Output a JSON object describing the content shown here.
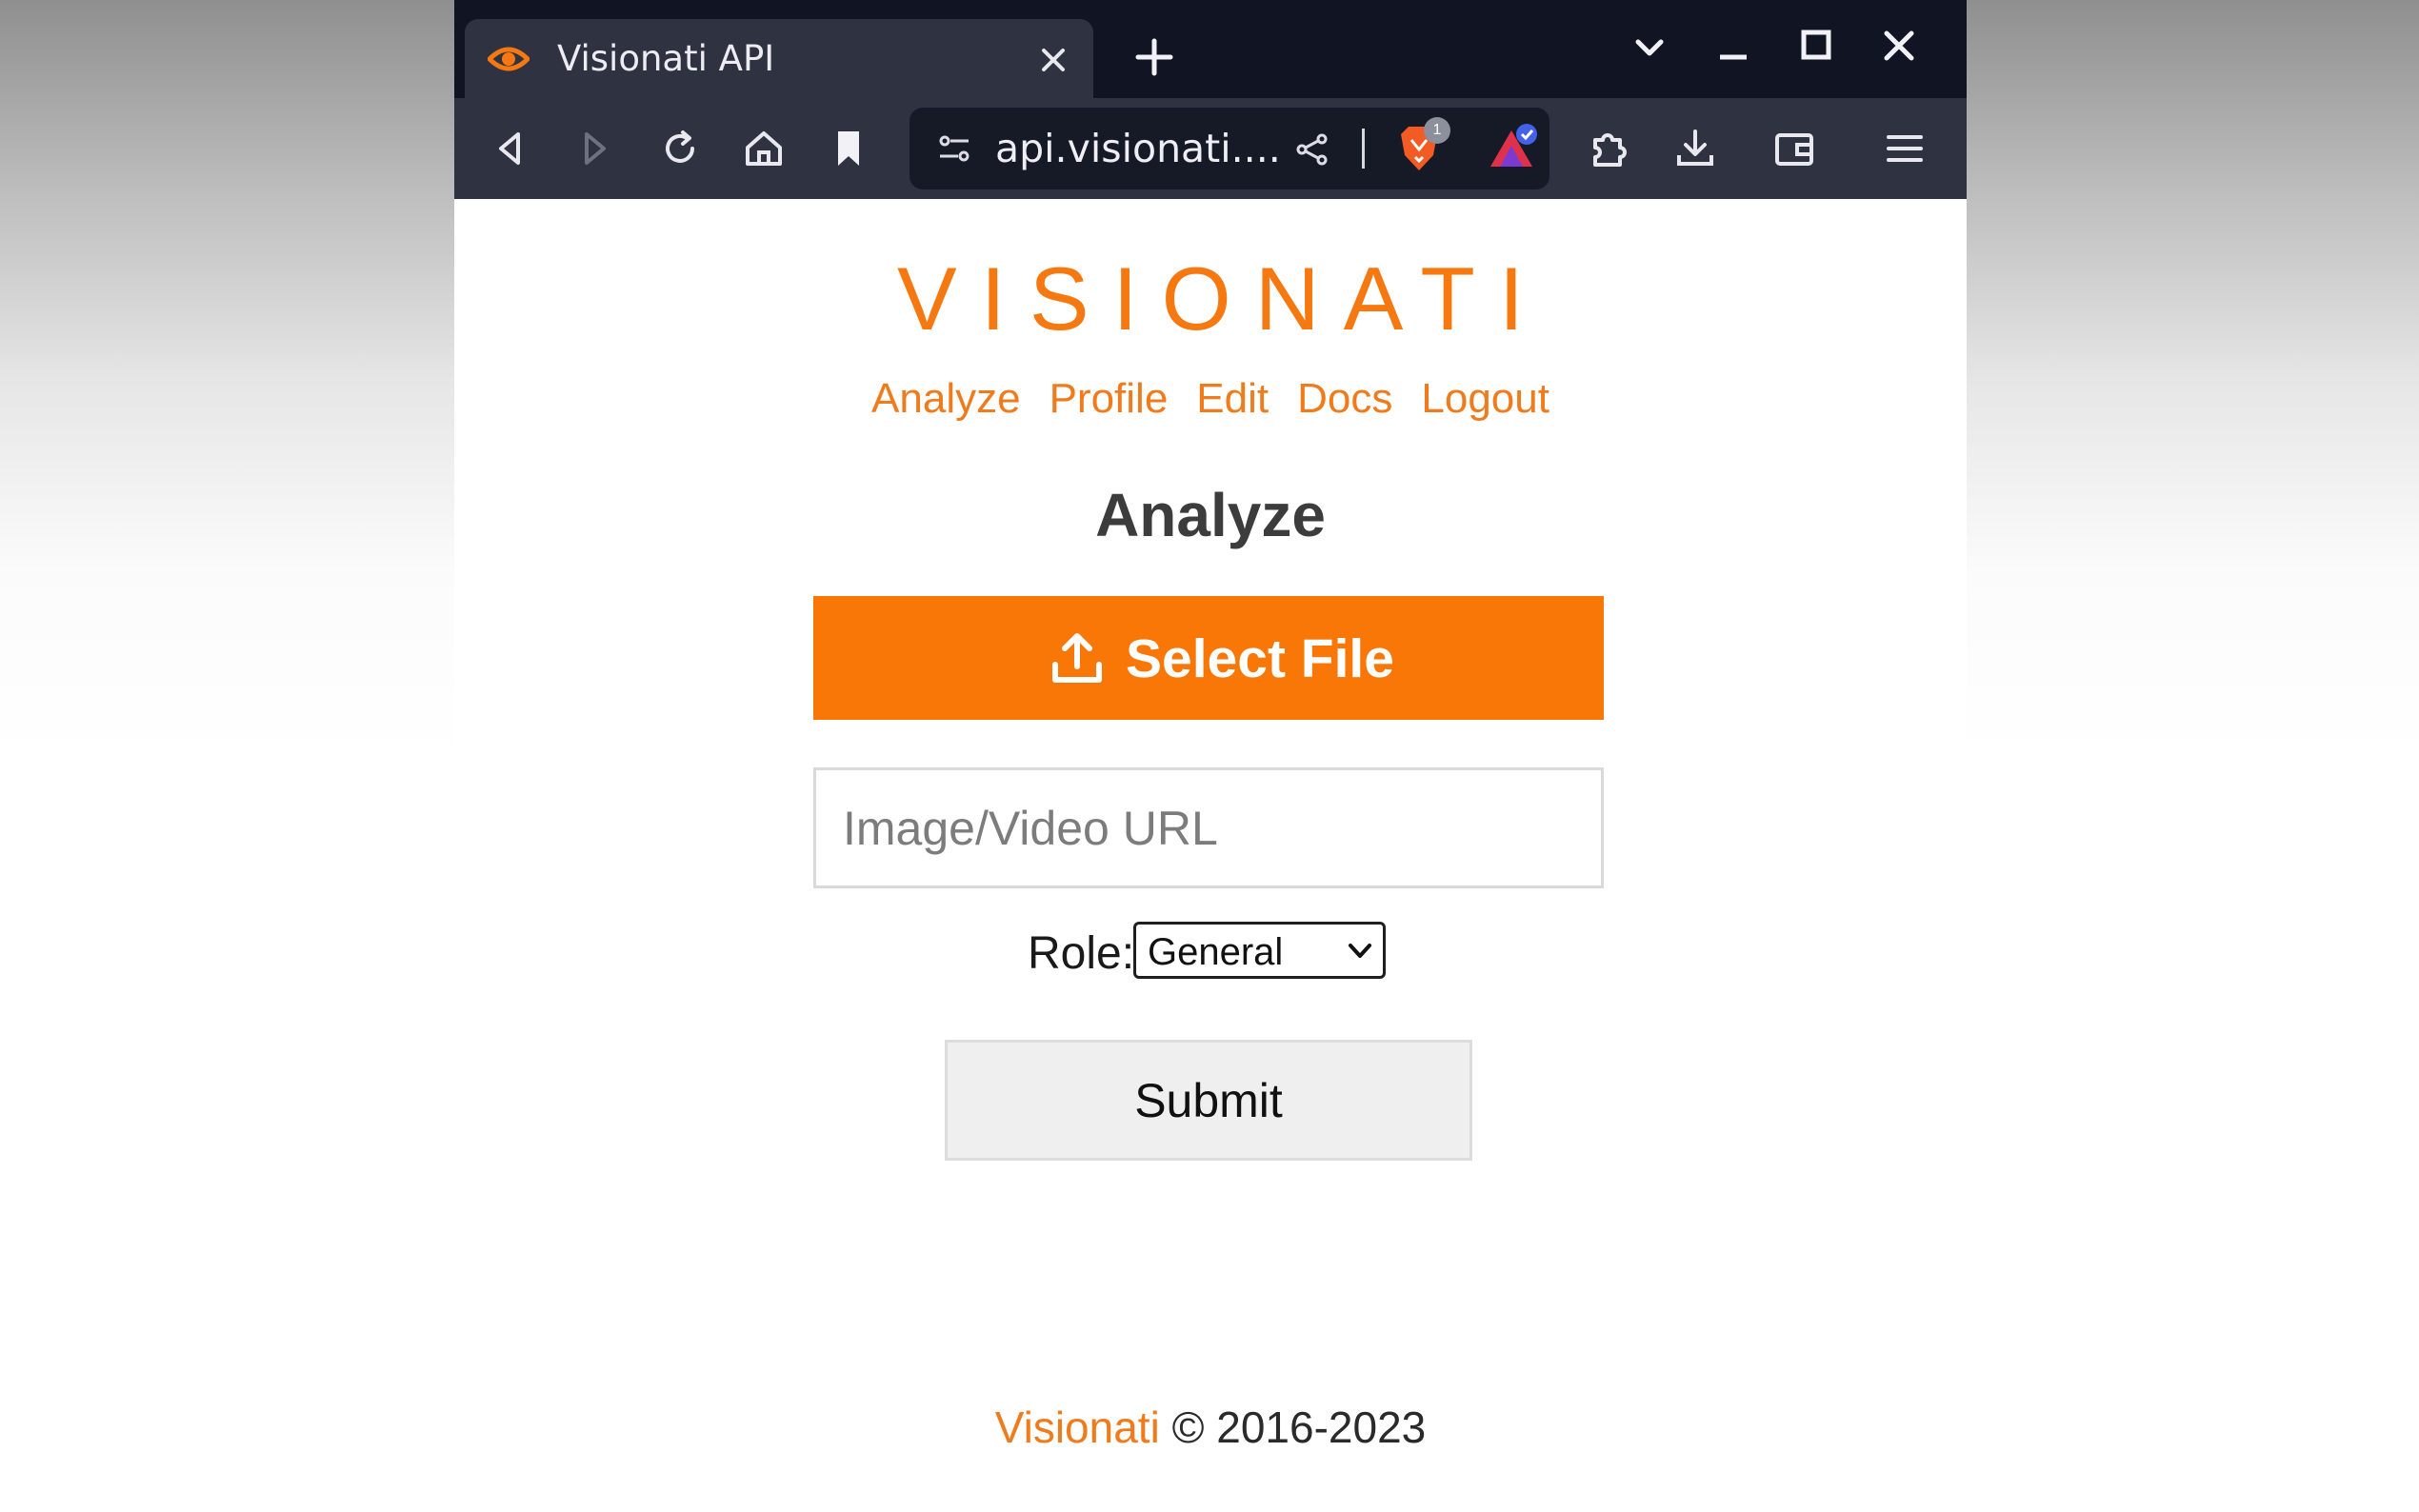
{
  "browser": {
    "tab": {
      "title": "Visionati API",
      "favicon": "eye-icon"
    },
    "address_bar": {
      "url_display": "api.visionati...."
    },
    "shields_badge": "1",
    "icons": [
      "back-icon",
      "forward-icon",
      "reload-icon",
      "home-icon",
      "bookmark-icon",
      "site-settings-icon",
      "share-icon",
      "brave-shields-icon",
      "brave-rewards-icon",
      "extensions-icon",
      "download-icon",
      "wallet-icon",
      "menu-icon",
      "tab-search-chevron-icon",
      "minimize-icon",
      "maximize-icon",
      "close-icon",
      "new-tab-icon"
    ]
  },
  "page": {
    "logo": "VISIONATI",
    "nav": [
      "Analyze",
      "Profile",
      "Edit",
      "Docs",
      "Logout"
    ],
    "heading": "Analyze",
    "select_file_label": "Select File",
    "url_placeholder": "Image/Video URL",
    "role_label": "Role:",
    "role_selected": "General",
    "submit_label": "Submit",
    "footer_brand": "Visionati",
    "footer_copy": "© 2016-2023"
  },
  "colors": {
    "brand_orange": "#f57811",
    "button_orange": "#f97706",
    "tabstrip_bg": "#101423",
    "toolbar_bg": "#2e3241"
  }
}
